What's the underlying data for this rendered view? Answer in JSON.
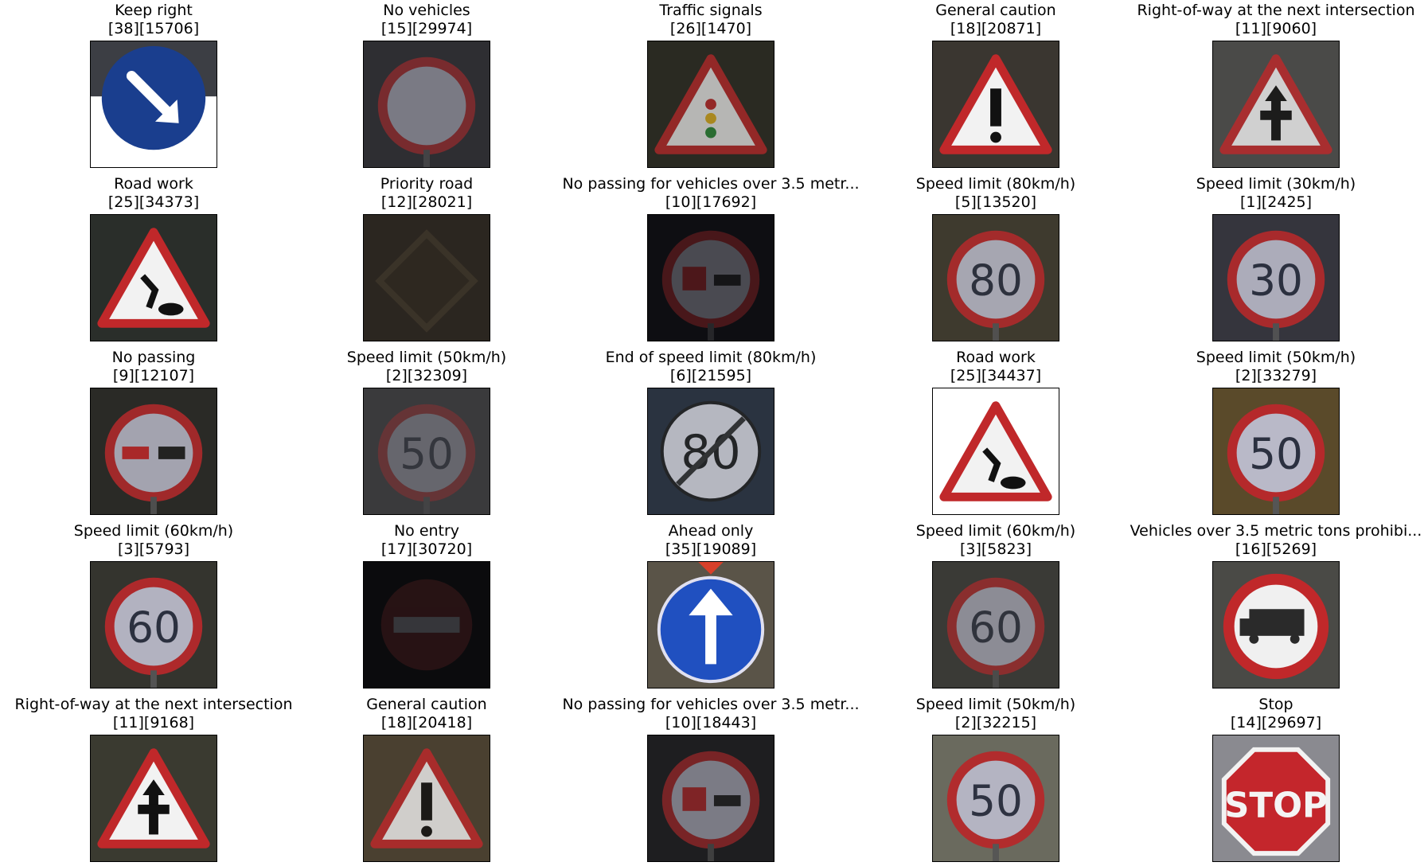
{
  "figure": {
    "rows": 5,
    "cols": 5,
    "items": [
      {
        "title": "Keep right",
        "ids": "[38][15706]",
        "icon": "keep-right-sign"
      },
      {
        "title": "No vehicles",
        "ids": "[15][29974]",
        "icon": "no-vehicles-sign"
      },
      {
        "title": "Traffic signals",
        "ids": "[26][1470]",
        "icon": "traffic-signals-sign"
      },
      {
        "title": "General caution",
        "ids": "[18][20871]",
        "icon": "general-caution-sign"
      },
      {
        "title": "Right-of-way at the next intersection",
        "ids": "[11][9060]",
        "icon": "right-of-way-sign"
      },
      {
        "title": "Road work",
        "ids": "[25][34373]",
        "icon": "road-work-sign"
      },
      {
        "title": "Priority road",
        "ids": "[12][28021]",
        "icon": "priority-road-sign"
      },
      {
        "title": "No passing for vehicles over 3.5 metr...",
        "ids": "[10][17692]",
        "icon": "no-passing-trucks-sign"
      },
      {
        "title": "Speed limit (80km/h)",
        "ids": "[5][13520]",
        "icon": "speed-limit-80-sign"
      },
      {
        "title": "Speed limit (30km/h)",
        "ids": "[1][2425]",
        "icon": "speed-limit-30-sign"
      },
      {
        "title": "No passing",
        "ids": "[9][12107]",
        "icon": "no-passing-sign"
      },
      {
        "title": "Speed limit (50km/h)",
        "ids": "[2][32309]",
        "icon": "speed-limit-50-sign"
      },
      {
        "title": "End of speed limit (80km/h)",
        "ids": "[6][21595]",
        "icon": "end-speed-limit-80-sign"
      },
      {
        "title": "Road work",
        "ids": "[25][34437]",
        "icon": "road-work-sign"
      },
      {
        "title": "Speed limit (50km/h)",
        "ids": "[2][33279]",
        "icon": "speed-limit-50-sign"
      },
      {
        "title": "Speed limit (60km/h)",
        "ids": "[3][5793]",
        "icon": "speed-limit-60-sign"
      },
      {
        "title": "No entry",
        "ids": "[17][30720]",
        "icon": "no-entry-sign"
      },
      {
        "title": "Ahead only",
        "ids": "[35][19089]",
        "icon": "ahead-only-sign"
      },
      {
        "title": "Speed limit (60km/h)",
        "ids": "[3][5823]",
        "icon": "speed-limit-60-sign"
      },
      {
        "title": "Vehicles over 3.5 metric tons prohibi...",
        "ids": "[16][5269]",
        "icon": "trucks-prohibited-sign"
      },
      {
        "title": "Right-of-way at the next intersection",
        "ids": "[11][9168]",
        "icon": "right-of-way-sign"
      },
      {
        "title": "General caution",
        "ids": "[18][20418]",
        "icon": "general-caution-sign"
      },
      {
        "title": "No passing for vehicles over 3.5 metr...",
        "ids": "[10][18443]",
        "icon": "no-passing-trucks-sign"
      },
      {
        "title": "Speed limit (50km/h)",
        "ids": "[2][32215]",
        "icon": "speed-limit-50-sign"
      },
      {
        "title": "Stop",
        "ids": "[14][29697]",
        "icon": "stop-sign"
      }
    ]
  }
}
